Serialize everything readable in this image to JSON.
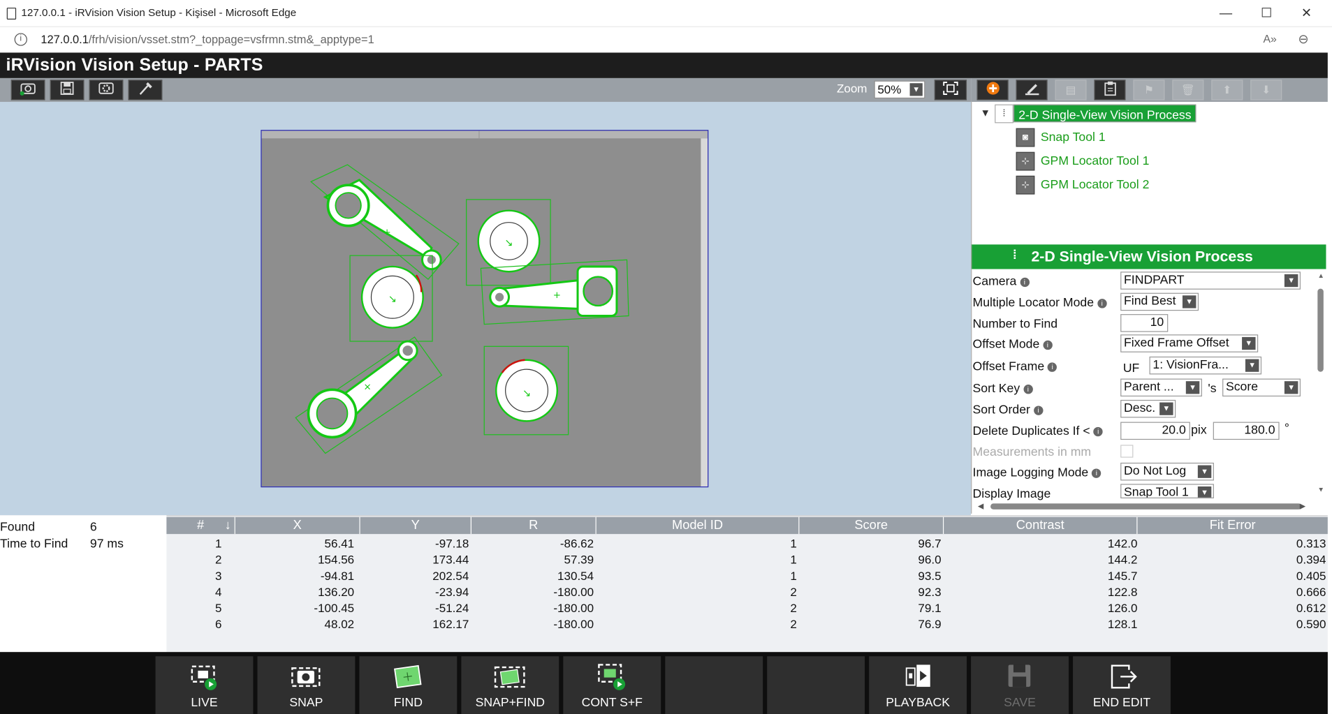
{
  "browser": {
    "tab_title": "127.0.0.1 - iRVision Vision Setup - Kişisel - Microsoft Edge",
    "url_host": "127.0.0.1",
    "url_path": "/frh/vision/vsset.stm?_toppage=vsfrmn.stm&_apptype=1",
    "minimize": "—",
    "maximize": "☐",
    "close": "✕",
    "read_aloud": "A»",
    "zoom_icon": "⊖"
  },
  "app": {
    "title": "iRVision Vision Setup - PARTS",
    "zoom_label": "Zoom",
    "zoom_value": "50%"
  },
  "tree": {
    "root": "2-D Single-View Vision Process",
    "children": [
      "Snap Tool 1",
      "GPM Locator Tool 1",
      "GPM Locator Tool 2"
    ]
  },
  "props": {
    "header": "2-D Single-View Vision Process",
    "camera_label": "Camera",
    "camera_value": "FINDPART",
    "mlm_label": "Multiple Locator Mode",
    "mlm_value": "Find Best",
    "ntf_label": "Number to Find",
    "ntf_value": "10",
    "offset_mode_label": "Offset Mode",
    "offset_mode_value": "Fixed Frame Offset",
    "offset_frame_label": "Offset Frame",
    "offset_frame_prefix": "UF",
    "offset_frame_value": "1: VisionFra...",
    "sort_key_label": "Sort Key",
    "sort_key_value": "Parent ...",
    "sort_key_sep": "'s",
    "sort_key_value2": "Score",
    "sort_order_label": "Sort Order",
    "sort_order_value": "Desc.",
    "del_dup_label": "Delete Duplicates If <",
    "del_dup_pix": "20.0",
    "pix_unit": "pix",
    "del_dup_deg": "180.0",
    "deg_unit": "°",
    "meas_mm_label": "Measurements in mm",
    "img_log_label": "Image Logging Mode",
    "img_log_value": "Do Not Log",
    "display_image_label": "Display Image",
    "display_image_value": "Snap Tool 1"
  },
  "summary": {
    "found_label": "Found",
    "found_value": "6",
    "ttf_label": "Time to Find",
    "ttf_value": "97 ms"
  },
  "table": {
    "headers": [
      "#",
      "X",
      "Y",
      "R",
      "Model ID",
      "Score",
      "Contrast",
      "Fit Error"
    ],
    "sort_arrow": "↓",
    "rows": [
      [
        "1",
        "56.41",
        "-97.18",
        "-86.62",
        "1",
        "96.7",
        "142.0",
        "0.313"
      ],
      [
        "2",
        "154.56",
        "173.44",
        "57.39",
        "1",
        "96.0",
        "144.2",
        "0.394"
      ],
      [
        "3",
        "-94.81",
        "202.54",
        "130.54",
        "1",
        "93.5",
        "145.7",
        "0.405"
      ],
      [
        "4",
        "136.20",
        "-23.94",
        "-180.00",
        "2",
        "92.3",
        "122.8",
        "0.666"
      ],
      [
        "5",
        "-100.45",
        "-51.24",
        "-180.00",
        "2",
        "79.1",
        "126.0",
        "0.612"
      ],
      [
        "6",
        "48.02",
        "162.17",
        "-180.00",
        "2",
        "76.9",
        "128.1",
        "0.590"
      ]
    ]
  },
  "buttons": {
    "live": "LIVE",
    "snap": "SNAP",
    "find": "FIND",
    "snapfind": "SNAP+FIND",
    "cont": "CONT S+F",
    "playback": "PLAYBACK",
    "save": "SAVE",
    "endedit": "END EDIT"
  },
  "colors": {
    "accent_green": "#18a035",
    "header_dark": "#1d1d1d",
    "image_bg": "#c1d3e3"
  }
}
